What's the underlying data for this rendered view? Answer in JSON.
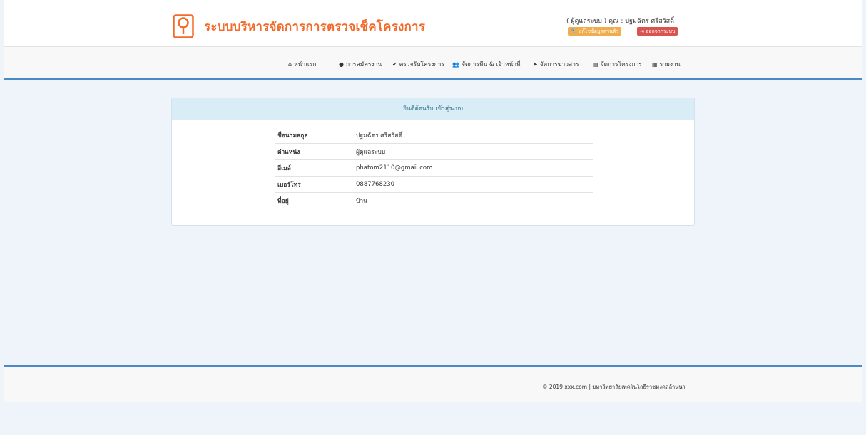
{
  "header": {
    "site_title": "ระบบบริหารจัดการการตรวจเช็คโครงการ",
    "user_info": "( ผู้ดูแลระบบ ) คุณ : ปฐมฉัตร ศรีสวัสดิ์",
    "edit_profile_label": "แก้ไขข้อมูลส่วนตัว",
    "logout_label": "ออกจากระบบ"
  },
  "nav": {
    "items": [
      {
        "label": "หน้าแรก",
        "icon": "home-icon"
      },
      {
        "label": "การสมัครงาน",
        "icon": "user-icon"
      },
      {
        "label": "ตรวจรับโครงการ",
        "icon": "check-icon"
      },
      {
        "label": "จัดการทีม & เจ้าหน้าที่",
        "icon": "users-icon"
      },
      {
        "label": "จัดการข่าวสาร",
        "icon": "send-icon"
      },
      {
        "label": "จัดการโครงการ",
        "icon": "file-icon"
      },
      {
        "label": "รายงาน",
        "icon": "chart-icon"
      }
    ]
  },
  "panel": {
    "heading": "ยินดีต้อนรับ เข้าสู่ระบบ",
    "rows": [
      {
        "label": "ชื่อนามสกุล",
        "value": "ปฐมฉัตร ศรีสวัสดิ์"
      },
      {
        "label": "ตำแหน่ง",
        "value": "ผู้ดูแลระบบ"
      },
      {
        "label": "อีเมล์",
        "value": "phatom2110@gmail.com"
      },
      {
        "label": "เบอร์โทร",
        "value": "0887768230"
      },
      {
        "label": "ที่อยู่",
        "value": "บ้าน"
      }
    ]
  },
  "footer": {
    "text": "© 2019 xxx.com | มหาวิทยาลัยเทคโนโลยีราชมงคลล้านนา"
  },
  "colors": {
    "brand_orange": "#f26b2a",
    "nav_border_blue": "#4a8ac7",
    "panel_heading_bg": "#d9edf7",
    "edit_button": "#f0ad4e",
    "logout_button": "#d9534f"
  }
}
